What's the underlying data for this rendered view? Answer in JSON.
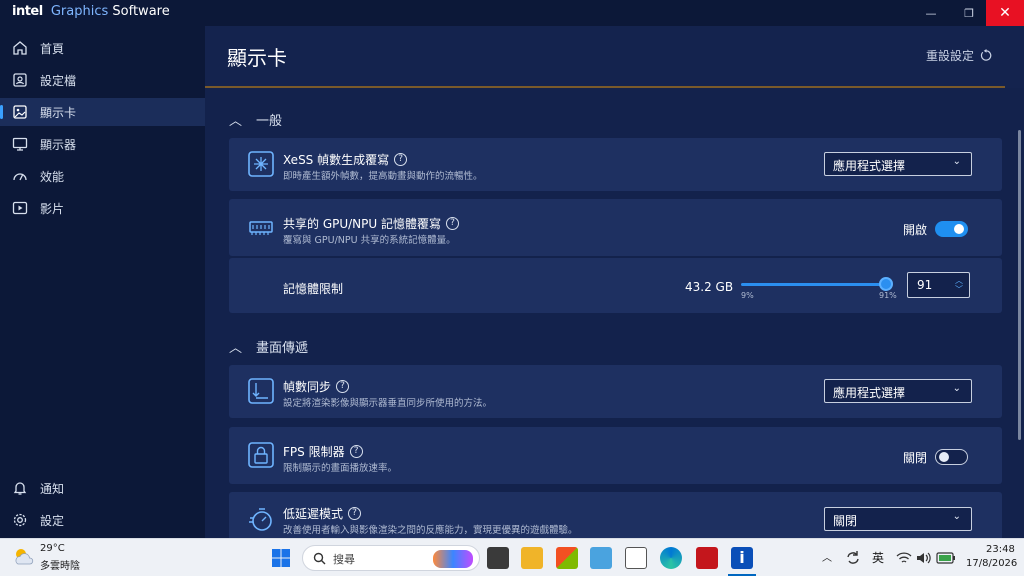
{
  "window": {
    "brand_intel": "intel",
    "brand_graphics": "Graphics",
    "brand_software": "Software",
    "minimize": "—",
    "maximize": "❐",
    "close": "✕"
  },
  "sidebar": {
    "items": [
      {
        "label": "首頁",
        "icon": "home-icon"
      },
      {
        "label": "設定檔",
        "icon": "profile-icon"
      },
      {
        "label": "顯示卡",
        "icon": "graphics-icon",
        "active": true
      },
      {
        "label": "顯示器",
        "icon": "monitor-icon"
      },
      {
        "label": "效能",
        "icon": "performance-icon"
      },
      {
        "label": "影片",
        "icon": "video-icon"
      }
    ],
    "bottom": [
      {
        "label": "通知",
        "icon": "bell-icon"
      },
      {
        "label": "設定",
        "icon": "gear-icon"
      }
    ]
  },
  "header": {
    "title": "顯示卡",
    "reset_label": "重設設定"
  },
  "sections": {
    "general": "一般",
    "display": "畫面傳遞"
  },
  "cards": {
    "xess": {
      "title": "XeSS 幀數生成覆寫",
      "subtitle": "即時產生額外幀數，提高動畫與動作的流暢性。",
      "select": "應用程式選擇"
    },
    "shared_mem": {
      "title": "共享的 GPU/NPU 記憶體覆寫",
      "subtitle": "覆寫與 GPU/NPU 共享的系統記憶體量。",
      "toggle_label": "開啟",
      "toggle_on": true
    },
    "mem_limit": {
      "title": "記憶體限制",
      "value": "43.2 GB",
      "slider_min": "9%",
      "slider_max": "91%",
      "slider_fraction": 0.91,
      "stepper_value": "91"
    },
    "vsync": {
      "title": "幀數同步",
      "subtitle": "設定將渲染影像與顯示器垂直同步所使用的方法。",
      "select": "應用程式選擇"
    },
    "fps": {
      "title": "FPS 限制器",
      "subtitle": "限制顯示的畫面播放速率。",
      "toggle_label": "關閉",
      "toggle_on": false
    },
    "latency": {
      "title": "低延遲模式",
      "subtitle": "改善使用者輸入與影像渲染之間的反應能力，實現更優異的遊戲體驗。",
      "select": "關閉"
    }
  },
  "taskbar": {
    "weather_temp": "29°C",
    "weather_desc": "多雲時陰",
    "search_placeholder": "搜尋",
    "ime": "英",
    "time": "23:48",
    "date": "17/8/2026"
  },
  "colors": {
    "accent": "#1f8ff0",
    "close_red": "#e81123",
    "sidebar": "#0c1838",
    "card": "#1e3061"
  }
}
